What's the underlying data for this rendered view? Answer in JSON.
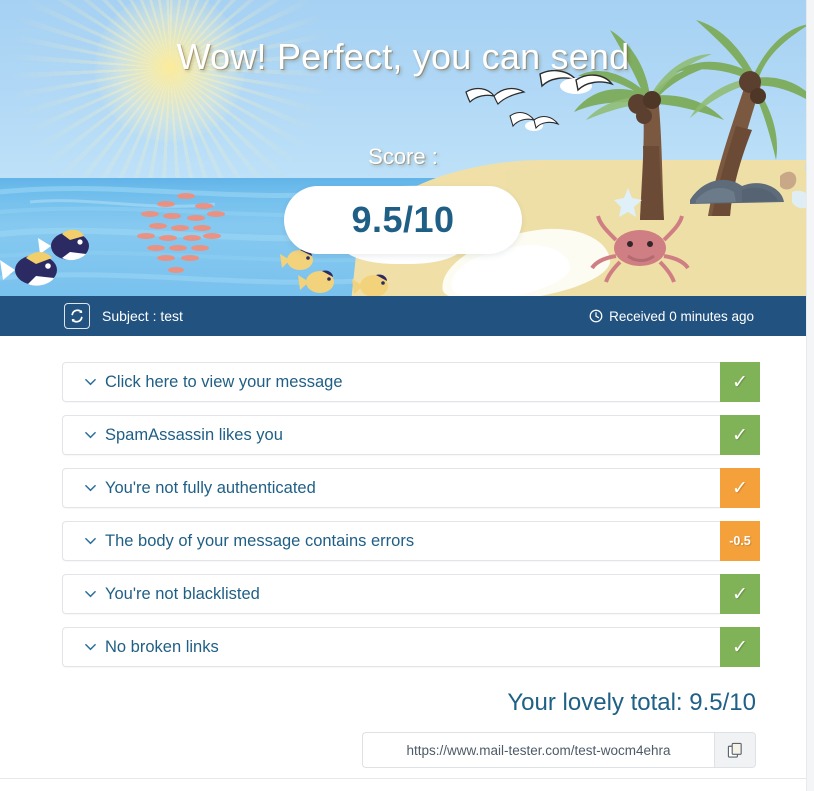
{
  "hero": {
    "title": "Wow! Perfect, you can send",
    "score_label": "Score :",
    "score_value": "9.5/10"
  },
  "toolbar": {
    "refresh_icon": "refresh-icon",
    "subject": "Subject : test",
    "clock_icon": "clock-icon",
    "received": "Received 0 minutes ago"
  },
  "results": {
    "rows": [
      {
        "label": "Click here to view your message",
        "badge": "✓",
        "badge_type": "green",
        "chevron": "chevron-down-icon"
      },
      {
        "label": "SpamAssassin likes you",
        "badge": "✓",
        "badge_type": "green",
        "chevron": "chevron-down-icon"
      },
      {
        "label": "You're not fully authenticated",
        "badge": "✓",
        "badge_type": "orange",
        "chevron": "chevron-down-icon"
      },
      {
        "label": "The body of your message contains errors",
        "badge": "-0.5",
        "badge_type": "orange",
        "chevron": "chevron-down-icon"
      },
      {
        "label": "You're not blacklisted",
        "badge": "✓",
        "badge_type": "green",
        "chevron": "chevron-down-icon"
      },
      {
        "label": "No broken links",
        "badge": "✓",
        "badge_type": "green",
        "chevron": "chevron-down-icon"
      }
    ]
  },
  "footer": {
    "total": "Your lovely total: 9.5/10",
    "url_value": "https://www.mail-tester.com/test-wocm4ehra",
    "copy_icon": "copy-icon"
  },
  "colors": {
    "toolbar_blue": "#225380",
    "accent_blue": "#1f5f86",
    "green": "#80b257",
    "orange": "#f4a13c",
    "sea": "#79c2ee",
    "sand": "#efdfa6"
  }
}
